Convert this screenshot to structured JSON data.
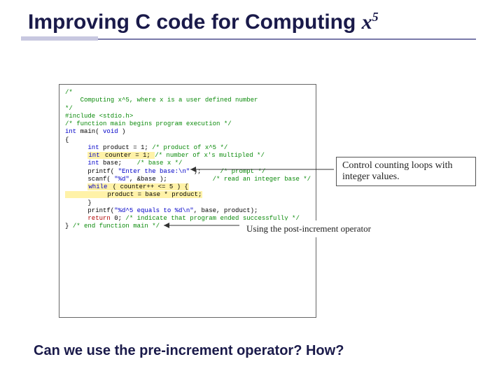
{
  "title_prefix": "Improving C code for Computing ",
  "title_var": "x",
  "title_exp": "5",
  "code": {
    "l01": "/*",
    "l02": "    Computing x^5, where x is a user defined number",
    "l03": "*/",
    "l04": "",
    "l05": "#include <stdio.h>",
    "l06": "",
    "l07": "/* function main begins program execution */",
    "l08a": "int",
    "l08b": " main( ",
    "l08c": "void",
    "l08d": " )",
    "l09": "{",
    "l10a": "      ",
    "l10b": "int",
    "l10c": " product = 1; ",
    "l10d": "/* product of x^5 */",
    "l11a": "      ",
    "l11b": "int",
    "l11c": " counter = 1; ",
    "l11d": "/* number of x's multipled */",
    "l12a": "      ",
    "l12b": "int",
    "l12c": " base;    ",
    "l12d": "/* base x */",
    "l13": "",
    "l14a": "      printf( ",
    "l14b": "\"Enter the base:\\n\"",
    "l14c": " );     ",
    "l14d": "/* prompt */",
    "l15a": "      scanf( ",
    "l15b": "\"%d\"",
    "l15c": ", &base );            ",
    "l15d": "/* read an integer base */",
    "l16": "",
    "l17a": "      ",
    "l17b": "while",
    "l17c": " ( counter++ <= 5 ) {",
    "l18": "           product = base * product;",
    "l19": "      }",
    "l20": "",
    "l21a": "      printf(",
    "l21b": "\"%d^5 equals to %d\\n\"",
    "l21c": ", base, product);",
    "l22": "",
    "l23a": "      ",
    "l23b": "return",
    "l23c": " 0; ",
    "l23d": "/* indicate that program ended successfully */",
    "l24": "",
    "l25": "} ",
    "l25b": "/* end function main */"
  },
  "note_counting": "Control counting loops with integer values.",
  "note_postinc": "Using the post-increment operator",
  "question": "Can we use the pre-increment operator? How?"
}
